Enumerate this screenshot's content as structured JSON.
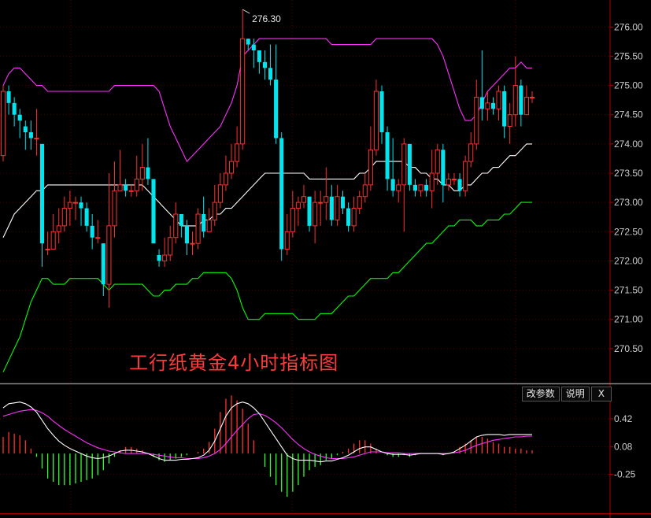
{
  "caption": "工行纸黄金4小时指标图",
  "toolbar": {
    "params_label": "改参数",
    "help_label": "说明",
    "close_label": "X"
  },
  "colors": {
    "up": "#ff3030",
    "down": "#00e5ee",
    "upper_band": "#ff30ff",
    "mid_band": "#ffffff",
    "lower_band": "#00ff00",
    "dif": "#ffffff",
    "dea": "#ff30ff",
    "hist_pos": "#ff3030",
    "hist_neg": "#30ff30",
    "axis": "#cfcfcf",
    "grid": "#3a0000"
  },
  "chart_data": [
    {
      "type": "candlestick",
      "title": "",
      "ylim": [
        270.0,
        276.3
      ],
      "yticks": [
        "276.00",
        "275.50",
        "275.00",
        "274.50",
        "274.00",
        "273.50",
        "273.00",
        "272.50",
        "272.00",
        "271.50",
        "271.00",
        "270.50"
      ],
      "high_annotation": "276.30",
      "candles": [
        [
          273.8,
          274.9,
          275.0,
          273.7
        ],
        [
          274.9,
          274.7,
          275.0,
          274.5
        ],
        [
          274.7,
          274.5,
          274.8,
          274.3
        ],
        [
          274.5,
          274.4,
          274.6,
          274.1
        ],
        [
          274.3,
          274.2,
          274.4,
          273.9
        ],
        [
          274.2,
          274.1,
          274.4,
          273.9
        ],
        [
          274.1,
          274.1,
          274.6,
          273.8
        ],
        [
          274.0,
          272.3,
          274.0,
          271.9
        ],
        [
          272.2,
          272.2,
          272.5,
          272.1
        ],
        [
          272.2,
          272.5,
          272.8,
          272.2
        ],
        [
          272.5,
          272.6,
          272.9,
          272.3
        ],
        [
          272.6,
          272.9,
          273.1,
          272.5
        ],
        [
          272.9,
          273.0,
          273.2,
          272.6
        ],
        [
          273.0,
          273.0,
          273.1,
          272.7
        ],
        [
          273.0,
          272.9,
          273.1,
          272.6
        ],
        [
          272.9,
          272.6,
          273.0,
          272.5
        ],
        [
          272.6,
          272.4,
          272.8,
          272.2
        ],
        [
          272.4,
          272.4,
          272.7,
          272.3
        ],
        [
          272.3,
          271.6,
          272.3,
          271.4
        ],
        [
          271.6,
          272.6,
          273.5,
          271.2
        ],
        [
          272.6,
          273.2,
          273.7,
          272.4
        ],
        [
          273.2,
          273.3,
          273.9,
          273.2
        ],
        [
          273.3,
          273.2,
          273.4,
          273.1
        ],
        [
          273.2,
          273.2,
          273.3,
          273.1
        ],
        [
          273.2,
          273.4,
          273.8,
          273.1
        ],
        [
          273.4,
          273.6,
          274.0,
          273.2
        ],
        [
          273.6,
          273.4,
          274.1,
          273.3
        ],
        [
          273.4,
          272.3,
          273.4,
          272.3
        ],
        [
          272.1,
          272.0,
          272.2,
          271.9
        ],
        [
          272.0,
          272.1,
          272.4,
          271.9
        ],
        [
          272.1,
          272.4,
          272.6,
          272.0
        ],
        [
          272.4,
          272.8,
          273.0,
          272.3
        ],
        [
          272.8,
          272.6,
          272.8,
          272.4
        ],
        [
          272.6,
          272.3,
          272.7,
          272.1
        ],
        [
          272.3,
          272.3,
          272.5,
          272.1
        ],
        [
          272.3,
          272.8,
          272.9,
          272.2
        ],
        [
          272.8,
          272.5,
          273.1,
          272.4
        ],
        [
          272.5,
          272.7,
          272.9,
          272.5
        ],
        [
          272.7,
          273.0,
          273.3,
          272.6
        ],
        [
          273.0,
          273.3,
          273.5,
          272.9
        ],
        [
          273.3,
          273.5,
          273.8,
          273.2
        ],
        [
          273.5,
          273.7,
          274.0,
          273.4
        ],
        [
          273.7,
          274.0,
          274.3,
          273.6
        ],
        [
          274.0,
          275.8,
          276.3,
          273.9
        ],
        [
          275.8,
          275.7,
          275.8,
          275.6
        ],
        [
          275.7,
          275.6,
          275.8,
          275.3
        ],
        [
          275.6,
          275.4,
          275.6,
          275.2
        ],
        [
          275.4,
          275.3,
          275.6,
          275.1
        ],
        [
          275.3,
          275.1,
          275.7,
          275.0
        ],
        [
          275.1,
          274.1,
          275.7,
          274.0
        ],
        [
          274.1,
          272.2,
          274.2,
          272.0
        ],
        [
          272.2,
          272.5,
          272.8,
          272.1
        ],
        [
          272.5,
          272.9,
          273.2,
          272.4
        ],
        [
          272.9,
          273.0,
          273.1,
          272.6
        ],
        [
          273.0,
          273.1,
          273.3,
          272.9
        ],
        [
          273.1,
          272.6,
          273.1,
          272.5
        ],
        [
          272.6,
          273.0,
          273.2,
          272.3
        ],
        [
          273.0,
          273.0,
          273.2,
          272.6
        ],
        [
          273.0,
          273.1,
          273.6,
          272.7
        ],
        [
          273.1,
          272.7,
          273.3,
          272.6
        ],
        [
          272.7,
          273.1,
          273.3,
          272.6
        ],
        [
          273.1,
          272.9,
          273.2,
          272.8
        ],
        [
          272.9,
          272.6,
          273.0,
          272.5
        ],
        [
          272.6,
          272.9,
          273.1,
          272.5
        ],
        [
          272.9,
          273.1,
          273.2,
          272.8
        ],
        [
          273.1,
          273.3,
          273.5,
          273.0
        ],
        [
          273.3,
          273.9,
          274.3,
          273.2
        ],
        [
          273.9,
          274.9,
          275.1,
          273.8
        ],
        [
          274.9,
          274.2,
          275.0,
          274.0
        ],
        [
          274.2,
          273.4,
          274.3,
          273.2
        ],
        [
          273.4,
          273.2,
          274.1,
          273.1
        ],
        [
          273.2,
          273.3,
          273.4,
          273.0
        ],
        [
          273.3,
          274.0,
          274.1,
          272.5
        ],
        [
          274.0,
          273.3,
          274.0,
          273.2
        ],
        [
          273.3,
          273.2,
          273.4,
          273.1
        ],
        [
          273.2,
          273.3,
          273.3,
          273.1
        ],
        [
          273.3,
          273.2,
          273.4,
          273.1
        ],
        [
          273.2,
          273.5,
          273.9,
          272.9
        ],
        [
          273.5,
          273.9,
          274.0,
          273.3
        ],
        [
          273.9,
          273.3,
          274.0,
          273.0
        ],
        [
          273.3,
          273.4,
          273.5,
          273.2
        ],
        [
          273.4,
          273.4,
          273.5,
          273.3
        ],
        [
          273.4,
          273.2,
          273.5,
          273.1
        ],
        [
          273.2,
          273.7,
          273.8,
          273.1
        ],
        [
          273.7,
          274.0,
          274.2,
          273.6
        ],
        [
          274.0,
          274.8,
          275.1,
          273.9
        ],
        [
          274.8,
          274.6,
          275.6,
          274.4
        ],
        [
          274.6,
          274.7,
          274.9,
          274.4
        ],
        [
          274.7,
          274.6,
          274.8,
          274.5
        ],
        [
          274.6,
          274.9,
          275.0,
          274.4
        ],
        [
          274.9,
          274.3,
          275.0,
          274.1
        ],
        [
          274.3,
          274.5,
          274.7,
          274.0
        ],
        [
          274.5,
          275.0,
          275.5,
          274.3
        ],
        [
          275.0,
          274.5,
          275.1,
          274.3
        ],
        [
          274.5,
          274.8,
          275.0,
          274.5
        ],
        [
          274.8,
          274.8,
          274.9,
          274.7
        ]
      ],
      "upper_band": [
        275.0,
        275.2,
        275.3,
        275.3,
        275.2,
        275.1,
        275.0,
        275.0,
        274.9,
        274.9,
        274.9,
        274.9,
        274.9,
        274.9,
        274.9,
        274.9,
        274.9,
        274.9,
        274.9,
        274.9,
        275.0,
        275.0,
        275.0,
        275.0,
        275.0,
        275.0,
        275.0,
        275.0,
        274.9,
        274.6,
        274.3,
        274.1,
        273.9,
        273.7,
        273.8,
        273.9,
        274.0,
        274.1,
        274.2,
        274.3,
        274.5,
        274.7,
        275.0,
        275.5,
        275.6,
        275.7,
        275.8,
        275.8,
        275.8,
        275.8,
        275.8,
        275.8,
        275.8,
        275.8,
        275.8,
        275.8,
        275.8,
        275.8,
        275.8,
        275.7,
        275.7,
        275.7,
        275.7,
        275.7,
        275.7,
        275.7,
        275.7,
        275.8,
        275.8,
        275.8,
        275.8,
        275.8,
        275.8,
        275.8,
        275.8,
        275.8,
        275.8,
        275.8,
        275.7,
        275.5,
        275.2,
        274.9,
        274.6,
        274.4,
        274.4,
        274.5,
        274.7,
        274.9,
        275.0,
        275.1,
        275.2,
        275.3,
        275.3,
        275.4,
        275.3,
        275.3
      ],
      "mid_band": [
        272.4,
        272.6,
        272.8,
        272.9,
        273.0,
        273.1,
        273.2,
        273.2,
        273.3,
        273.3,
        273.3,
        273.3,
        273.3,
        273.3,
        273.3,
        273.3,
        273.3,
        273.3,
        273.3,
        273.3,
        273.3,
        273.3,
        273.3,
        273.3,
        273.3,
        273.3,
        273.2,
        273.1,
        273.0,
        272.9,
        272.8,
        272.7,
        272.6,
        272.6,
        272.6,
        272.6,
        272.7,
        272.7,
        272.8,
        272.8,
        272.9,
        272.9,
        273.0,
        273.1,
        273.2,
        273.3,
        273.4,
        273.5,
        273.5,
        273.5,
        273.5,
        273.5,
        273.5,
        273.5,
        273.5,
        273.4,
        273.4,
        273.4,
        273.4,
        273.4,
        273.4,
        273.4,
        273.4,
        273.4,
        273.5,
        273.5,
        273.6,
        273.7,
        273.7,
        273.7,
        273.7,
        273.7,
        273.7,
        273.6,
        273.6,
        273.5,
        273.5,
        273.4,
        273.4,
        273.3,
        273.3,
        273.2,
        273.2,
        273.3,
        273.3,
        273.4,
        273.5,
        273.5,
        273.6,
        273.6,
        273.7,
        273.8,
        273.8,
        273.9,
        274.0,
        274.0
      ],
      "lower_band": [
        270.1,
        270.3,
        270.5,
        270.7,
        271.0,
        271.3,
        271.5,
        271.7,
        271.7,
        271.6,
        271.6,
        271.6,
        271.7,
        271.7,
        271.7,
        271.7,
        271.7,
        271.7,
        271.6,
        271.5,
        271.6,
        271.6,
        271.6,
        271.6,
        271.6,
        271.6,
        271.5,
        271.4,
        271.4,
        271.5,
        271.5,
        271.6,
        271.6,
        271.6,
        271.7,
        271.7,
        271.8,
        271.8,
        271.8,
        271.8,
        271.8,
        271.7,
        271.5,
        271.2,
        271.0,
        271.0,
        271.0,
        271.1,
        271.1,
        271.1,
        271.1,
        271.1,
        271.1,
        271.0,
        271.0,
        271.0,
        271.0,
        271.1,
        271.1,
        271.1,
        271.2,
        271.3,
        271.4,
        271.4,
        271.5,
        271.6,
        271.7,
        271.7,
        271.7,
        271.7,
        271.8,
        271.8,
        271.9,
        272.0,
        272.1,
        272.2,
        272.3,
        272.3,
        272.4,
        272.5,
        272.6,
        272.6,
        272.7,
        272.7,
        272.7,
        272.6,
        272.6,
        272.7,
        272.7,
        272.7,
        272.8,
        272.8,
        272.9,
        273.0,
        273.0,
        273.0
      ]
    },
    {
      "type": "macd",
      "title": "",
      "ylim": [
        -0.7,
        0.75
      ],
      "yticks": [
        "0.42",
        "0.08",
        "-0.25"
      ],
      "dif": [
        0.55,
        0.6,
        0.61,
        0.62,
        0.6,
        0.56,
        0.5,
        0.4,
        0.3,
        0.22,
        0.15,
        0.1,
        0.06,
        0.03,
        0.0,
        -0.03,
        -0.05,
        -0.06,
        -0.05,
        -0.03,
        0.0,
        0.03,
        0.04,
        0.04,
        0.03,
        0.02,
        0.0,
        -0.03,
        -0.06,
        -0.08,
        -0.08,
        -0.08,
        -0.07,
        -0.07,
        -0.06,
        -0.05,
        -0.02,
        0.04,
        0.15,
        0.3,
        0.45,
        0.55,
        0.6,
        0.62,
        0.6,
        0.55,
        0.48,
        0.38,
        0.28,
        0.18,
        0.08,
        -0.02,
        -0.06,
        -0.08,
        -0.08,
        -0.08,
        -0.09,
        -0.1,
        -0.09,
        -0.09,
        -0.07,
        -0.05,
        -0.02,
        0.02,
        0.06,
        0.08,
        0.08,
        0.05,
        0.02,
        0.0,
        -0.01,
        -0.01,
        -0.01,
        -0.02,
        -0.01,
        0.0,
        0.0,
        0.0,
        0.0,
        -0.01,
        0.0,
        0.02,
        0.06,
        0.1,
        0.15,
        0.2,
        0.22,
        0.23,
        0.23,
        0.23,
        0.22,
        0.23,
        0.23,
        0.23,
        0.23,
        0.23
      ],
      "dea": [
        0.45,
        0.47,
        0.49,
        0.51,
        0.52,
        0.53,
        0.52,
        0.49,
        0.45,
        0.39,
        0.34,
        0.29,
        0.25,
        0.21,
        0.17,
        0.13,
        0.1,
        0.07,
        0.05,
        0.03,
        0.02,
        0.01,
        0.0,
        0.0,
        0.0,
        0.0,
        0.0,
        -0.01,
        -0.02,
        -0.03,
        -0.04,
        -0.05,
        -0.05,
        -0.06,
        -0.06,
        -0.06,
        -0.05,
        -0.03,
        0.0,
        0.05,
        0.12,
        0.2,
        0.28,
        0.35,
        0.42,
        0.47,
        0.48,
        0.46,
        0.42,
        0.37,
        0.31,
        0.24,
        0.17,
        0.11,
        0.06,
        0.02,
        -0.01,
        -0.03,
        -0.05,
        -0.06,
        -0.06,
        -0.06,
        -0.05,
        -0.04,
        -0.02,
        0.0,
        0.02,
        0.02,
        0.02,
        0.01,
        0.01,
        0.01,
        0.0,
        0.0,
        0.0,
        0.0,
        0.0,
        0.0,
        0.0,
        0.0,
        0.0,
        0.01,
        0.02,
        0.04,
        0.07,
        0.1,
        0.12,
        0.14,
        0.16,
        0.17,
        0.18,
        0.19,
        0.2,
        0.2,
        0.21,
        0.21
      ]
    }
  ]
}
